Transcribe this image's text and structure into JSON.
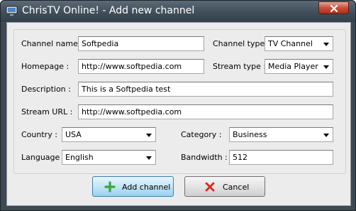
{
  "window": {
    "title": "ChrisTV Online! - Add new channel"
  },
  "form": {
    "channel_name": {
      "label": "Channel name :",
      "value": "Softpedia"
    },
    "channel_type": {
      "label": "Channel type :",
      "value": "TV Channel"
    },
    "homepage": {
      "label": "Homepage :",
      "value": "http://www.softpedia.com"
    },
    "stream_type": {
      "label": "Stream type :",
      "value": "Media Player"
    },
    "description": {
      "label": "Description :",
      "value": "This is a Softpedia test"
    },
    "stream_url": {
      "label": "Stream URL :",
      "value": "http://www.softpedia.com"
    },
    "country": {
      "label": "Country :",
      "value": "USA"
    },
    "category": {
      "label": "Category :",
      "value": "Business"
    },
    "language": {
      "label": "Language :",
      "value": "English"
    },
    "bandwidth": {
      "label": "Bandwidth :",
      "value": "512"
    }
  },
  "buttons": {
    "add_label": "Add channel",
    "cancel_label": "Cancel"
  },
  "colors": {
    "titlebar": "#3e4c58",
    "client": "#ececec",
    "add_icon": "#3aa838",
    "cancel_icon": "#d8281e"
  },
  "icons": {
    "app": "monitor-icon",
    "close": "close-icon",
    "add": "plus-icon",
    "cancel": "x-icon"
  }
}
